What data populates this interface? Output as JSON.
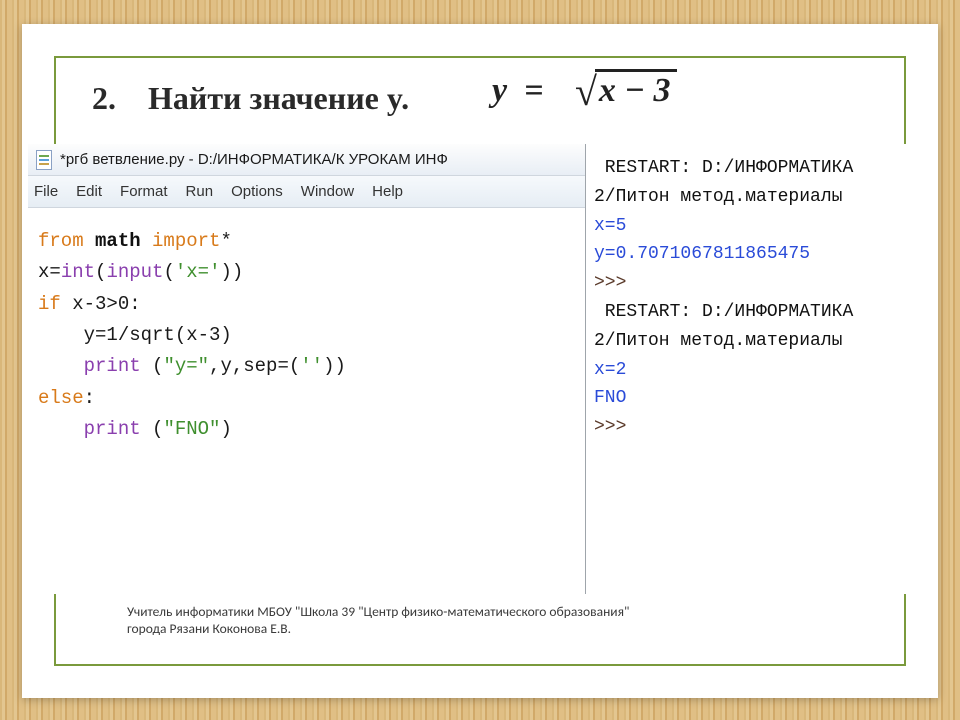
{
  "heading": {
    "number": "2.",
    "task": "Найти значение y.",
    "formula_lhs": "y",
    "formula_eq": "=",
    "formula_radicand": "x − 3"
  },
  "editor": {
    "title_prefix": "*ргб ветвление.ру - D:/ИНФОРМАТИКА/К УРОКАМ ИНФ",
    "menu": {
      "file": "File",
      "edit": "Edit",
      "format": "Format",
      "run": "Run",
      "options": "Options",
      "window": "Window",
      "help": "Help"
    },
    "code": {
      "l1_from": "from",
      "l1_math": "math",
      "l1_import": "import",
      "l1_star": "*",
      "l2_a": "x=",
      "l2_int": "int",
      "l2_b": "(",
      "l2_input": "input",
      "l2_c": "(",
      "l2_str": "'x='",
      "l2_d": "))",
      "l3_if": "if",
      "l3_cond": " x-3>0:",
      "l4": "    y=1/sqrt(x-3)",
      "l5_a": "    ",
      "l5_print": "print",
      "l5_b": " (",
      "l5_str1": "\"y=\"",
      "l5_c": ",y,sep=(",
      "l5_str2": "''",
      "l5_d": "))",
      "l6_else": "else",
      "l6_colon": ":",
      "l7_a": "    ",
      "l7_print": "print",
      "l7_b": " (",
      "l7_str": "\"FNO\"",
      "l7_c": ")"
    }
  },
  "shell": {
    "r1_restart": " RESTART: D:/ИНФОРМАТИКА",
    "r1_path": "2/Питон метод.материалы",
    "r1_x": "x=5",
    "r1_y": "y=0.7071067811865475",
    "prompt": ">>>",
    "r2_restart": " RESTART: D:/ИНФОРМАТИКА",
    "r2_path": "2/Питон метод.материалы",
    "r2_x": "x=2",
    "r2_out": "FNO"
  },
  "footer": {
    "line1": "Учитель информатики МБОУ \"Школа 39 \"Центр физико-математического образования\"",
    "line2": "города Рязани Коконова Е.В."
  }
}
